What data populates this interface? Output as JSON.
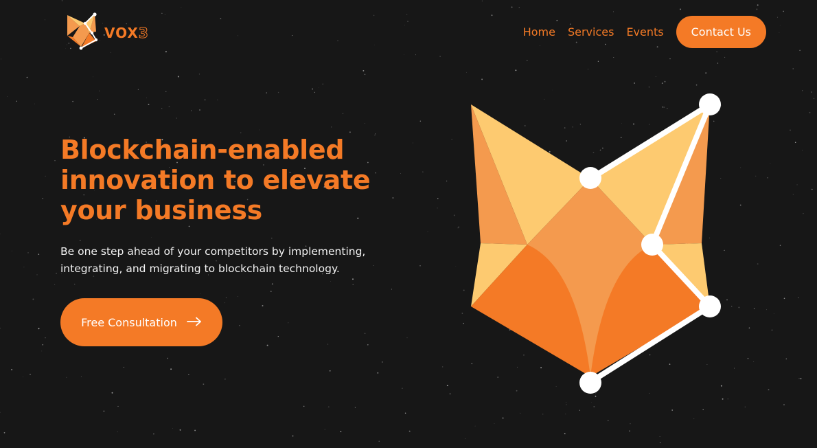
{
  "brand": {
    "name": "VOX",
    "suffix": "3",
    "logo_icon": "fox-head-icon",
    "color": "#f47a26"
  },
  "nav": {
    "items": [
      {
        "label": "Home"
      },
      {
        "label": "Services"
      },
      {
        "label": "Events"
      }
    ],
    "contact_label": "Contact Us"
  },
  "hero": {
    "title": "Blockchain-enabled innovation to elevate your business",
    "subtitle": "Be one step ahead of your competitors by implementing, integrating, and migrating to blockchain technology.",
    "cta_label": "Free Consultation",
    "cta_icon": "arrow-right-icon",
    "illustration": "geometric-fox-head-illustration"
  },
  "colors": {
    "background": "#171717",
    "accent": "#f47a26",
    "fox_light": "#fdca70",
    "fox_mid": "#f49a4e",
    "fox_dark": "#f47a26",
    "node": "#ffffff"
  }
}
